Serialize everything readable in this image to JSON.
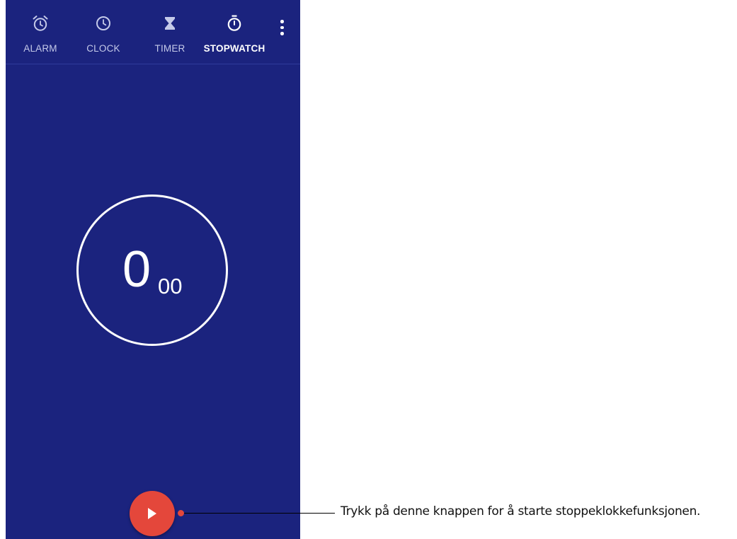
{
  "tabs": [
    {
      "label": "ALARM",
      "icon": "alarm-icon",
      "active": false
    },
    {
      "label": "CLOCK",
      "icon": "clock-icon",
      "active": false
    },
    {
      "label": "TIMER",
      "icon": "hourglass-icon",
      "active": false
    },
    {
      "label": "STOPWATCH",
      "icon": "stopwatch-icon",
      "active": true
    }
  ],
  "overflow_menu": {
    "icon": "more-vert-icon"
  },
  "stopwatch": {
    "seconds": "0",
    "hundredths": "00"
  },
  "start_button": {
    "icon": "play-icon"
  },
  "callout": {
    "text": "Trykk på denne knappen for å starte stoppeklokkefunksjonen."
  },
  "colors": {
    "background": "#1b237e",
    "fab": "#e4473b",
    "text": "#ffffff"
  }
}
